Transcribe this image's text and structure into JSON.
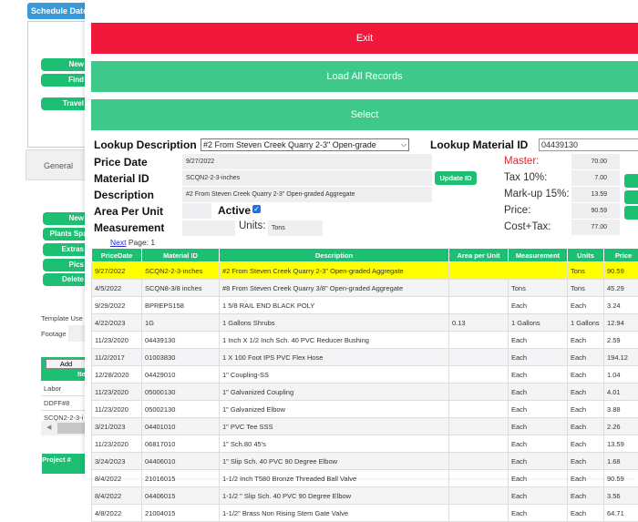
{
  "background": {
    "schedule_date": "Schedule Date",
    "top_buttons": [
      "New",
      "Find",
      "Travel"
    ],
    "tab": "General",
    "side_buttons": [
      "New",
      "Plants Spac",
      "Extras",
      "Pics",
      "Delete"
    ],
    "template_use": "Template Use",
    "footage": "Footage",
    "items_add": "Add",
    "items_header": "Ite",
    "items": [
      "Labor",
      "DDFF#8",
      "SCQN2-2-3-i"
    ],
    "project_header": "Project #"
  },
  "modal": {
    "exit": "Exit",
    "load_all": "Load All Records",
    "select": "Select",
    "lookup_description_label": "Lookup Description",
    "lookup_description_value": "#2 From Steven Creek Quarry 2-3\" Open-grade",
    "lookup_material_label": "Lookup Material ID",
    "lookup_material_value": "04439130",
    "price_date_label": "Price Date",
    "price_date": "9/27/2022",
    "material_id_label": "Material ID",
    "material_id": "SCQN2-2-3-inches",
    "update_id": "Update ID",
    "description_label": "Description",
    "description": "#2 From Steven Creek Quarry 2-3\" Open-graded Aggregate",
    "area_label": "Area Per Unit",
    "active_label": "Active",
    "active": true,
    "measurement_label": "Measurement",
    "units_label": "Units:",
    "units": "Tons",
    "master_label": "Master:",
    "master": "70.00",
    "tax_label": "Tax 10%:",
    "tax": "7.00",
    "markup_label": "Mark-up 15%:",
    "markup": "13.59",
    "price_label": "Price:",
    "price": "90.59",
    "cost_tax_label": "Cost+Tax:",
    "cost_tax": "77.00",
    "next": "Next",
    "page": "Page: 1",
    "colors": {
      "exit": "#f0193c",
      "green": "#3ec98a",
      "header": "#1dbf73",
      "highlight": "#ffff00"
    }
  },
  "table": {
    "columns": [
      "PriceDate",
      "Material ID",
      "Description",
      "Area per Unit",
      "Measurement",
      "Units",
      "Price"
    ],
    "rows": [
      [
        "9/27/2022",
        "SCQN2-2-3-inches",
        "#2 From Steven Creek Quarry 2-3\" Open-graded Aggregate",
        "",
        "",
        "Tons",
        "90.59"
      ],
      [
        "4/5/2022",
        "SCQN8-3/8 inches",
        "#8 From Steven Creek Quarry 3/8\" Open-graded Aggregate",
        "",
        "Tons",
        "Tons",
        "45.29"
      ],
      [
        "9/29/2022",
        "BPREPS158",
        "1 5/8 RAIL END BLACK POLY",
        "",
        "Each",
        "Each",
        "3.24"
      ],
      [
        "4/22/2023",
        "1G",
        "1 Gallons Shrubs",
        "0.13",
        "1 Gallons",
        "1 Gallons",
        "12.94"
      ],
      [
        "11/23/2020",
        "04439130",
        "1 Inch X 1/2 Inch Sch. 40 PVC Reducer Bushing",
        "",
        "Each",
        "Each",
        "2.59"
      ],
      [
        "11/2/2017",
        "01003830",
        "1 X 100 Foot IPS PVC Flex Hose",
        "",
        "Each",
        "Each",
        "194.12"
      ],
      [
        "12/28/2020",
        "04429010",
        "1\" Coupling-SS",
        "",
        "Each",
        "Each",
        "1.04"
      ],
      [
        "11/23/2020",
        "05000130",
        "1\" Galvanized Coupling",
        "",
        "Each",
        "Each",
        "4.01"
      ],
      [
        "11/23/2020",
        "05002130",
        "1\" Galvanized Elbow",
        "",
        "Each",
        "Each",
        "3.88"
      ],
      [
        "3/21/2023",
        "04401010",
        "1\" PVC Tee SSS",
        "",
        "Each",
        "Each",
        "2.26"
      ],
      [
        "11/23/2020",
        "06817010",
        "1\" Sch.80 45's",
        "",
        "Each",
        "Each",
        "13.59"
      ],
      [
        "3/24/2023",
        "04406010",
        "1\" Slip Sch. 40 PVC 90 Degree Elbow",
        "",
        "Each",
        "Each",
        "1.68"
      ],
      [
        "8/4/2022",
        "21016015",
        "1-1/2 Inch T580 Bronze Threaded Ball Valve",
        "",
        "Each",
        "Each",
        "90.59"
      ],
      [
        "8/4/2022",
        "04406015",
        "1-1/2 \" Slip Sch. 40 PVC 90 Degree Elbow",
        "",
        "Each",
        "Each",
        "3.56"
      ],
      [
        "4/8/2022",
        "21004015",
        "1-1/2\" Brass Non Rising Stem Gate Valve",
        "",
        "Each",
        "Each",
        "64.71"
      ]
    ]
  }
}
